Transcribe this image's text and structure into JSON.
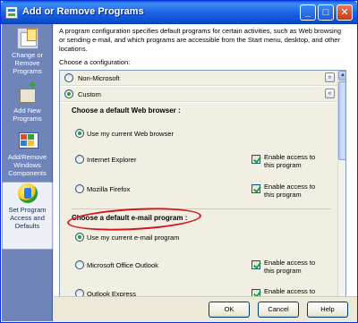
{
  "window": {
    "title": "Add or Remove Programs"
  },
  "titlebar": {
    "minimize": "_",
    "maximize": "□",
    "close": "✕"
  },
  "sidebar": {
    "items": [
      {
        "label": "Change or Remove Programs",
        "icon": "change-remove-programs-icon"
      },
      {
        "label": "Add New Programs",
        "icon": "add-new-programs-icon"
      },
      {
        "label": "Add/Remove Windows Components",
        "icon": "windows-components-icon"
      },
      {
        "label": "Set Program Access and Defaults",
        "icon": "program-defaults-icon"
      }
    ],
    "selected_index": 3
  },
  "main": {
    "intro": "A program configuration specifies default programs for certain activities, such as Web browsing or sending e-mail, and which programs are accessible from the Start menu, desktop, and other locations.",
    "choose_label": "Choose a configuration:",
    "configurations": [
      {
        "label": "Non-Microsoft",
        "selected": false,
        "expand": "»"
      },
      {
        "label": "Custom",
        "selected": true,
        "collapse": "«"
      }
    ],
    "browser_section": {
      "heading": "Choose a default Web browser :",
      "options": [
        {
          "label": "Use my current Web browser",
          "selected": true
        },
        {
          "label": "Internet Explorer",
          "selected": false,
          "enable_access": true
        },
        {
          "label": "Mozilla Firefox",
          "selected": false,
          "enable_access": true
        }
      ],
      "enable_label": "Enable access to this program"
    },
    "email_section": {
      "heading": "Choose a default e-mail program :",
      "options": [
        {
          "label": "Use my current e-mail program",
          "selected": true
        },
        {
          "label": "Microsoft Office Outlook",
          "selected": false,
          "enable_access": true
        },
        {
          "label": "Outlook Express",
          "selected": false,
          "enable_access": true
        }
      ],
      "enable_label": "Enable access to this program"
    },
    "annotation_color": "#d6141e"
  },
  "buttons": {
    "ok": "OK",
    "cancel": "Cancel",
    "help": "Help"
  },
  "colors": {
    "title_blue": "#0a4fd0",
    "sidebar": "#6f84b8",
    "panel": "#f1efe2",
    "check_green": "#21a121"
  }
}
